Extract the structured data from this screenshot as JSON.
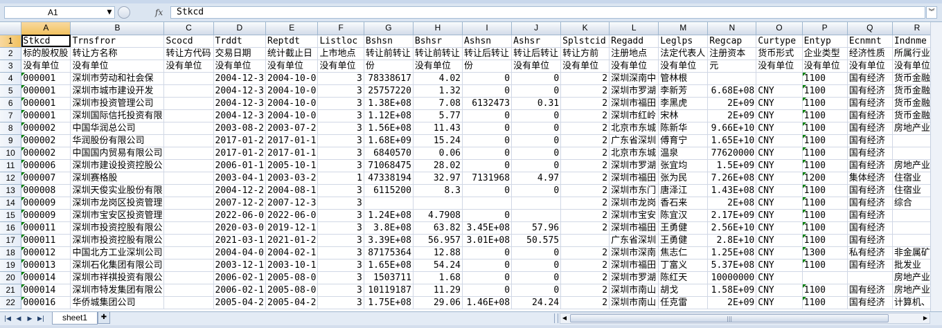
{
  "namebox": {
    "value": "A1"
  },
  "formula_bar": {
    "fx_label": "fx",
    "content": "Stkcd"
  },
  "columns": [
    "A",
    "B",
    "C",
    "D",
    "E",
    "F",
    "G",
    "H",
    "I",
    "J",
    "K",
    "L",
    "M",
    "N",
    "O",
    "P",
    "Q",
    "R"
  ],
  "rows": [
    {
      "n": "1",
      "cells": [
        "Stkcd",
        "Trnsfror",
        "Scocd",
        "Trddt",
        "Reptdt",
        "Listloc",
        "Bshsn",
        "Bshsr",
        "Ashsn",
        "Ashsr",
        "Splstcid",
        "Regadd",
        "Leglps",
        "Regcap",
        "Curtype",
        "Entyp",
        "Ecnmnt",
        "Indnme"
      ]
    },
    {
      "n": "2",
      "cells": [
        "标的股权股",
        "转让方名称",
        "转让方代码",
        "交易日期",
        "统计截止日",
        "上市地点",
        "转让前转让",
        "转让前转让",
        "转让后转让",
        "转让后转让",
        "转让方前",
        "注册地点",
        "法定代表人",
        "注册资本",
        "货币形式",
        "企业类型",
        "经济性质",
        "所属行业"
      ]
    },
    {
      "n": "3",
      "cells": [
        "没有单位",
        "没有单位",
        "没有单位",
        "没有单位",
        "没有单位",
        "没有单位",
        "份",
        "没有单位",
        "份",
        "没有单位",
        "没有单位",
        "没有单位",
        "没有单位",
        "元",
        "没有单位",
        "没有单位",
        "没有单位",
        "没有单位"
      ]
    },
    {
      "n": "4",
      "cells": [
        "000001",
        "深圳市劳动和社会保",
        "",
        "2004-12-3",
        "2004-10-0",
        "3",
        "78338617",
        "4.02",
        "0",
        "0",
        "2",
        "深圳深南中",
        "管林根",
        "",
        "",
        "1100",
        "国有经济",
        "货币金融服"
      ]
    },
    {
      "n": "5",
      "cells": [
        "000001",
        "深圳市城市建设开发",
        "",
        "2004-12-3",
        "2004-10-0",
        "3",
        "25757220",
        "1.32",
        "0",
        "0",
        "2",
        "深圳市罗湖",
        "李新芳",
        "6.68E+08",
        "CNY",
        "1100",
        "国有经济",
        "货币金融服"
      ]
    },
    {
      "n": "6",
      "cells": [
        "000001",
        "深圳市投资管理公司",
        "",
        "2004-12-3",
        "2004-10-0",
        "3",
        "1.38E+08",
        "7.08",
        "6132473",
        "0.31",
        "2",
        "深圳市福田",
        "李黑虎",
        "2E+09",
        "CNY",
        "1100",
        "国有经济",
        "货币金融服"
      ]
    },
    {
      "n": "7",
      "cells": [
        "000001",
        "深圳国际信托投资有限",
        "",
        "2004-12-3",
        "2004-10-0",
        "3",
        "1.12E+08",
        "5.77",
        "0",
        "0",
        "2",
        "深圳市红岭",
        "宋林",
        "2E+09",
        "CNY",
        "1100",
        "国有经济",
        "货币金融服"
      ]
    },
    {
      "n": "8",
      "cells": [
        "000002",
        "中国华润总公司",
        "",
        "2003-08-2",
        "2003-07-2",
        "3",
        "1.56E+08",
        "11.43",
        "0",
        "0",
        "2",
        "北京市东城",
        "陈新华",
        "9.66E+10",
        "CNY",
        "1100",
        "国有经济",
        "房地产业"
      ]
    },
    {
      "n": "9",
      "cells": [
        "000002",
        "华润股份有限公司",
        "",
        "2017-01-2",
        "2017-01-1",
        "3",
        "1.68E+09",
        "15.24",
        "0",
        "0",
        "2",
        "广东省深圳",
        "傅育宁",
        "1.65E+10",
        "CNY",
        "1100",
        "国有经济",
        ""
      ]
    },
    {
      "n": "10",
      "cells": [
        "000002",
        "中国国内贸易有限公司",
        "",
        "2017-01-2",
        "2017-01-1",
        "3",
        "6840570",
        "0.06",
        "0",
        "0",
        "2",
        "北京市东城",
        "温泉",
        "77620000",
        "CNY",
        "1100",
        "国有经济",
        ""
      ]
    },
    {
      "n": "11",
      "cells": [
        "000006",
        "深圳市建设投资控股公",
        "",
        "2006-01-1",
        "2005-10-1",
        "3",
        "71068475",
        "28.02",
        "0",
        "0",
        "2",
        "深圳市罗湖",
        "张宜均",
        "1.5E+09",
        "CNY",
        "1100",
        "国有经济",
        "房地产业"
      ]
    },
    {
      "n": "12",
      "cells": [
        "000007",
        "深圳赛格股",
        "",
        "2003-04-1",
        "2003-03-2",
        "1",
        "47338194",
        "32.97",
        "7131968",
        "4.97",
        "2",
        "深圳市福田",
        "张为民",
        "7.26E+08",
        "CNY",
        "1200",
        "集体经济",
        "住宿业"
      ]
    },
    {
      "n": "13",
      "cells": [
        "000008",
        "深圳天俊实业股份有限",
        "",
        "2004-12-2",
        "2004-08-1",
        "3",
        "6115200",
        "8.3",
        "0",
        "0",
        "2",
        "深圳市东门",
        "唐泽江",
        "1.43E+08",
        "CNY",
        "1100",
        "国有经济",
        "住宿业"
      ]
    },
    {
      "n": "14",
      "cells": [
        "000009",
        "深圳市龙岗区投资管理",
        "",
        "2007-12-2",
        "2007-12-3",
        "3",
        "",
        "",
        "",
        "",
        "2",
        "深圳市龙岗",
        "香石来",
        "2E+08",
        "CNY",
        "1100",
        "国有经济",
        "综合"
      ]
    },
    {
      "n": "15",
      "cells": [
        "000009",
        "深圳市宝安区投资管理",
        "",
        "2022-06-0",
        "2022-06-0",
        "3",
        "1.24E+08",
        "4.7908",
        "0",
        "",
        "2",
        "深圳市宝安",
        "陈宜汉",
        "2.17E+09",
        "CNY",
        "1100",
        "国有经济",
        ""
      ]
    },
    {
      "n": "16",
      "cells": [
        "000011",
        "深圳市投资控股有限公",
        "",
        "2020-03-0",
        "2019-12-1",
        "3",
        "3.8E+08",
        "63.82",
        "3.45E+08",
        "57.96",
        "2",
        "深圳市福田",
        "王勇健",
        "2.56E+10",
        "CNY",
        "1100",
        "国有经济",
        ""
      ]
    },
    {
      "n": "17",
      "cells": [
        "000011",
        "深圳市投资控股有限公",
        "",
        "2021-03-1",
        "2021-01-2",
        "3",
        "3.39E+08",
        "56.957",
        "3.01E+08",
        "50.575",
        "",
        "广东省深圳",
        "王勇健",
        "2.8E+10",
        "CNY",
        "1100",
        "国有经济",
        ""
      ]
    },
    {
      "n": "18",
      "cells": [
        "000012",
        "中国北方工业深圳公司",
        "",
        "2004-04-0",
        "2004-02-1",
        "3",
        "87175364",
        "12.88",
        "0",
        "0",
        "2",
        "深圳市深南",
        "焦志仁",
        "1.25E+08",
        "CNY",
        "1300",
        "私有经济",
        "非金属矿物"
      ]
    },
    {
      "n": "19",
      "cells": [
        "000013",
        "深圳石化集团有限公司",
        "",
        "2003-12-1",
        "2003-10-1",
        "3",
        "1.65E+08",
        "54.24",
        "0",
        "0",
        "2",
        "深圳市福田",
        "丁富义",
        "5.37E+08",
        "CNY",
        "1100",
        "国有经济",
        "批发业"
      ]
    },
    {
      "n": "20",
      "cells": [
        "000014",
        "深圳市祥祺投资有限公",
        "",
        "2006-02-1",
        "2005-08-0",
        "3",
        "1503711",
        "1.68",
        "0",
        "0",
        "2",
        "深圳市罗湖",
        "陈红天",
        "10000000",
        "CNY",
        "",
        "",
        "房地产业"
      ]
    },
    {
      "n": "21",
      "cells": [
        "000014",
        "深圳市特发集团有限公",
        "",
        "2006-02-1",
        "2005-08-0",
        "3",
        "10119187",
        "11.29",
        "0",
        "0",
        "2",
        "深圳市南山",
        "胡戈",
        "1.58E+09",
        "CNY",
        "1100",
        "国有经济",
        "房地产业"
      ]
    },
    {
      "n": "22",
      "cells": [
        "000016",
        "华侨城集团公司",
        "",
        "2005-04-2",
        "2005-04-2",
        "3",
        "1.75E+08",
        "29.06",
        "1.46E+08",
        "24.24",
        "2",
        "深圳市南山",
        "任克雷",
        "2E+09",
        "CNY",
        "1100",
        "国有经济",
        "计算机、通"
      ]
    }
  ],
  "sheet_tabs": [
    {
      "label": "sheet1",
      "active": true
    }
  ],
  "colors": {
    "header_bg": "#dbe5f1",
    "selected_header": "#f1c15f",
    "gridline": "#d0d7e5",
    "text_marker": "#008000"
  }
}
